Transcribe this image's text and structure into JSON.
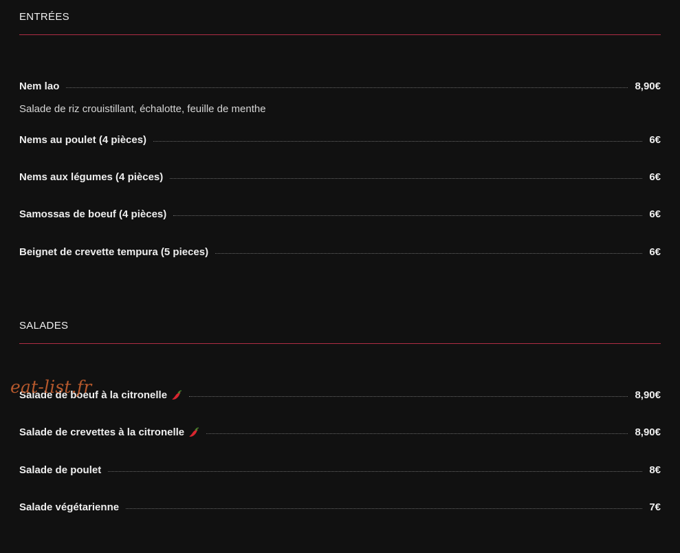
{
  "sections": [
    {
      "title": "ENTRÉES",
      "items": [
        {
          "name": "Nem lao",
          "price": "8,90€",
          "description": "Salade de riz crouistillant, échalotte, feuille de menthe"
        },
        {
          "name": "Nems au poulet (4 pièces)",
          "price": "6€"
        },
        {
          "name": "Nems aux légumes (4 pièces)",
          "price": "6€"
        },
        {
          "name": "Samossas de boeuf (4 pièces)",
          "price": "6€"
        },
        {
          "name": "Beignet de crevette tempura (5 pieces)",
          "price": "6€"
        }
      ]
    },
    {
      "title": "SALADES",
      "items": [
        {
          "name": "Salade de boeuf à la citronelle",
          "price": "8,90€",
          "icon": "chili-pepper-icon"
        },
        {
          "name": "Salade de crevettes à la citronelle",
          "price": "8,90€",
          "icon": "chili-pepper-icon"
        },
        {
          "name": "Salade de poulet",
          "price": "8€"
        },
        {
          "name": "Salade végétarienne",
          "price": "7€"
        }
      ]
    }
  ],
  "watermark": "eat-list.fr",
  "colors": {
    "background": "#111111",
    "text": "#eeeeee",
    "rule": "#b02d45",
    "watermark": "#c7602f",
    "chili": "#d8262f"
  }
}
